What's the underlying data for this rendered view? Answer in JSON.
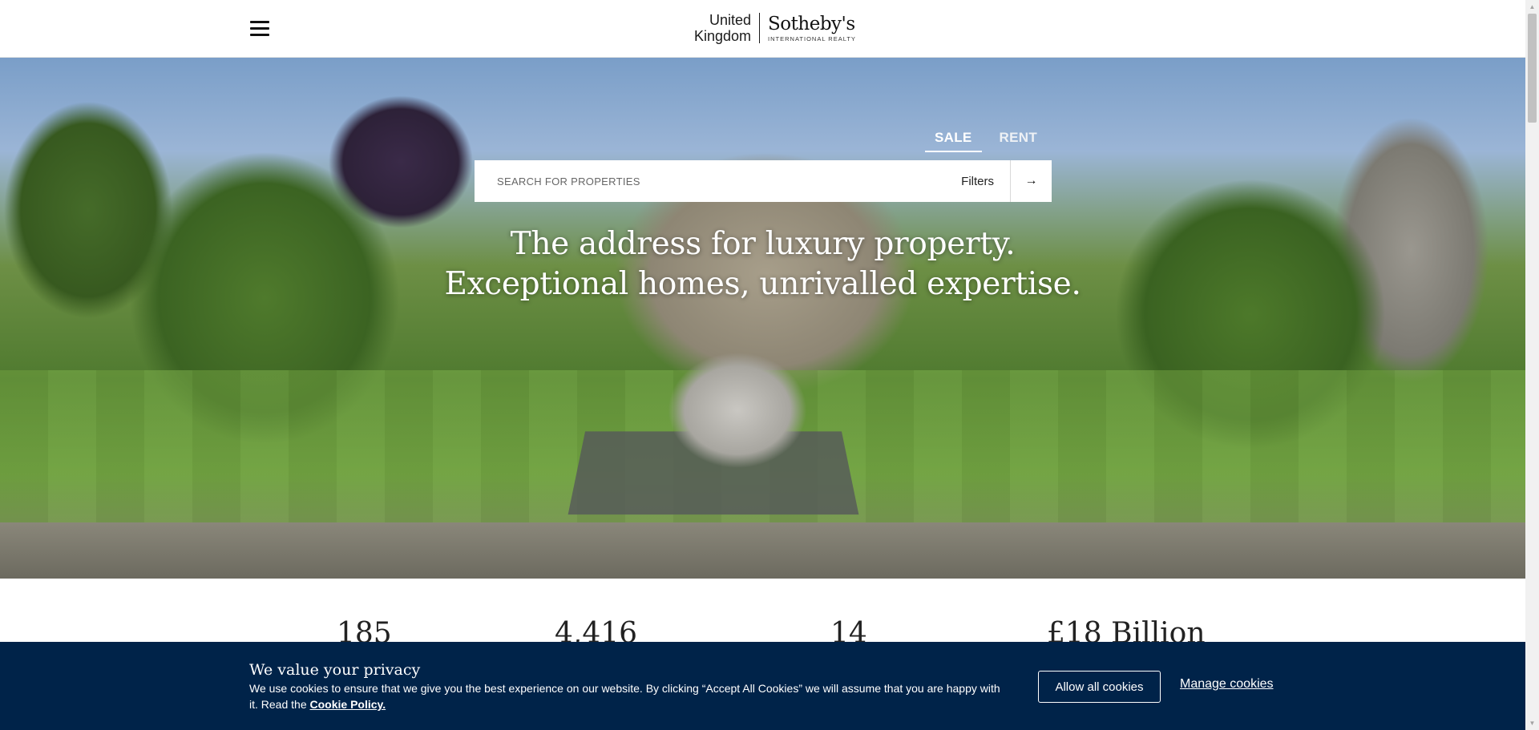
{
  "header": {
    "menu_icon": "hamburger-menu-icon",
    "logo": {
      "region_line1": "United",
      "region_line2": "Kingdom",
      "brand": "Sotheby's",
      "brand_sub": "INTERNATIONAL REALTY"
    }
  },
  "hero": {
    "tabs": [
      {
        "label": "SALE",
        "active": true
      },
      {
        "label": "RENT",
        "active": false
      }
    ],
    "search": {
      "placeholder": "SEARCH FOR PROPERTIES",
      "filters_label": "Filters",
      "submit_icon": "arrow-right-icon"
    },
    "headline_line1": "The address for luxury property.",
    "headline_line2": "Exceptional homes, unrivalled expertise."
  },
  "stats": [
    {
      "value": "185"
    },
    {
      "value": "4,416"
    },
    {
      "value": "14"
    },
    {
      "value": "£18 Billion"
    }
  ],
  "cookie_banner": {
    "title": "We value your privacy",
    "text": "We use cookies to ensure that we give you the best experience on our website. By clicking “Accept All Cookies” we will assume that you are happy with it. Read the",
    "policy_link": "Cookie Policy.",
    "allow_label": "Allow all cookies",
    "manage_label": "Manage cookies"
  },
  "colors": {
    "brand_navy": "#002349",
    "white": "#ffffff"
  }
}
